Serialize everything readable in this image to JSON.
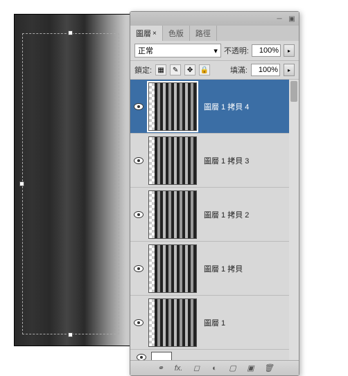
{
  "tabs": {
    "active": "圖層",
    "t2": "色版",
    "t3": "路徑"
  },
  "blend": {
    "mode": "正常",
    "opacity_label": "不透明:",
    "opacity_value": "100%",
    "fill_label": "填滿:",
    "fill_value": "100%"
  },
  "lock": {
    "label": "鎖定:"
  },
  "layers": [
    {
      "name": "圖層 1 拷貝 4",
      "selected": true,
      "visible": true
    },
    {
      "name": "圖層 1 拷貝 3",
      "selected": false,
      "visible": true
    },
    {
      "name": "圖層 1 拷貝 2",
      "selected": false,
      "visible": true
    },
    {
      "name": "圖層 1 拷貝",
      "selected": false,
      "visible": true
    },
    {
      "name": "圖層 1",
      "selected": false,
      "visible": true
    }
  ]
}
